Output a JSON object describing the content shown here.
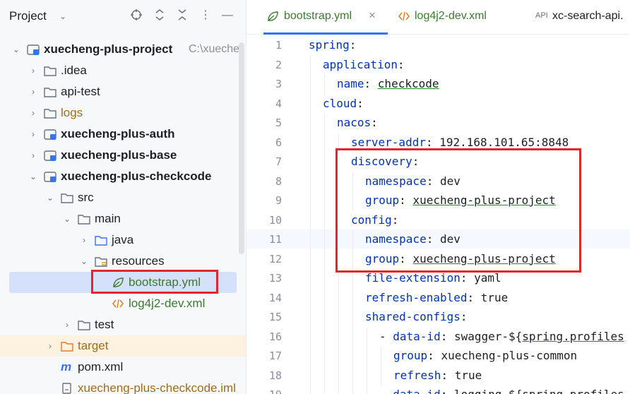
{
  "project_panel": {
    "title": "Project",
    "tree": [
      {
        "label": "xuecheng-plus-project",
        "path": "C:\\xuecher",
        "style": "bold",
        "icon": "module-folder-icon",
        "expanded": true
      },
      {
        "label": ".idea",
        "style": "normal",
        "icon": "folder-icon"
      },
      {
        "label": "api-test",
        "style": "normal",
        "icon": "folder-icon"
      },
      {
        "label": "logs",
        "style": "orange",
        "icon": "folder-icon"
      },
      {
        "label": "xuecheng-plus-auth",
        "style": "bold",
        "icon": "module-folder-icon"
      },
      {
        "label": "xuecheng-plus-base",
        "style": "bold",
        "icon": "module-folder-icon"
      },
      {
        "label": "xuecheng-plus-checkcode",
        "style": "bold",
        "icon": "module-folder-icon",
        "expanded": true
      },
      {
        "label": "src",
        "style": "normal",
        "icon": "folder-icon",
        "expanded": true
      },
      {
        "label": "main",
        "style": "normal",
        "icon": "folder-icon",
        "expanded": true
      },
      {
        "label": "java",
        "style": "normal",
        "icon": "source-folder-icon"
      },
      {
        "label": "resources",
        "style": "normal",
        "icon": "resources-folder-icon",
        "expanded": true
      },
      {
        "label": "bootstrap.yml",
        "style": "green",
        "icon": "spring-yml-icon",
        "selected": true
      },
      {
        "label": "log4j2-dev.xml",
        "style": "green",
        "icon": "xml-icon"
      },
      {
        "label": "test",
        "style": "normal",
        "icon": "folder-icon"
      },
      {
        "label": "target",
        "style": "yellow",
        "icon": "excluded-folder-icon"
      },
      {
        "label": "pom.xml",
        "style": "normal",
        "icon": "maven-icon"
      },
      {
        "label": "xuecheng-plus-checkcode.iml",
        "style": "yellow",
        "icon": "iml-file-icon"
      }
    ]
  },
  "editor": {
    "tabs": [
      {
        "label": "bootstrap.yml",
        "icon": "spring-yml-icon",
        "active": true,
        "close": "×"
      },
      {
        "label": "log4j2-dev.xml",
        "icon": "xml-icon"
      },
      {
        "label": "xc-search-api.",
        "icon": "api-icon",
        "icon_text": "API"
      }
    ],
    "current_line": 11,
    "lines": [
      {
        "n": "1",
        "key": "spring",
        "sep": ":",
        "val": ""
      },
      {
        "n": "2",
        "key": "application",
        "sep": ":",
        "val": ""
      },
      {
        "n": "3",
        "key": "name",
        "sep": ": ",
        "val": "checkcode"
      },
      {
        "n": "4",
        "key": "cloud",
        "sep": ":",
        "val": ""
      },
      {
        "n": "5",
        "key": "nacos",
        "sep": ":",
        "val": ""
      },
      {
        "n": "6",
        "key": "server-addr",
        "sep": ": ",
        "val": "192.168.101.65:8848"
      },
      {
        "n": "7",
        "key": "discovery",
        "sep": ":",
        "val": ""
      },
      {
        "n": "8",
        "key": "namespace",
        "sep": ": ",
        "val": "dev"
      },
      {
        "n": "9",
        "key": "group",
        "sep": ": ",
        "val": "xuecheng-plus-project"
      },
      {
        "n": "10",
        "key": "config",
        "sep": ":",
        "val": ""
      },
      {
        "n": "11",
        "key": "namespace",
        "sep": ": ",
        "val": "dev"
      },
      {
        "n": "12",
        "key": "group",
        "sep": ": ",
        "val": "xuecheng-plus-project"
      },
      {
        "n": "13",
        "key": "file-extension",
        "sep": ": ",
        "val": "yaml"
      },
      {
        "n": "14",
        "key": "refresh-enabled",
        "sep": ": ",
        "val": "true"
      },
      {
        "n": "15",
        "key": "shared-configs",
        "sep": ":",
        "val": ""
      },
      {
        "n": "16",
        "prefix": "- ",
        "key": "data-id",
        "sep": ": ",
        "val": "swagger-${",
        "val2": "spring.profiles"
      },
      {
        "n": "17",
        "key": "group",
        "sep": ": ",
        "val": "xuecheng-plus-common"
      },
      {
        "n": "18",
        "key": "refresh",
        "sep": ": ",
        "val": "true"
      },
      {
        "n": "19",
        "prefix": "- ",
        "key": "data-id",
        "sep": ": ",
        "val": "logging-${spring.profiles"
      }
    ]
  }
}
